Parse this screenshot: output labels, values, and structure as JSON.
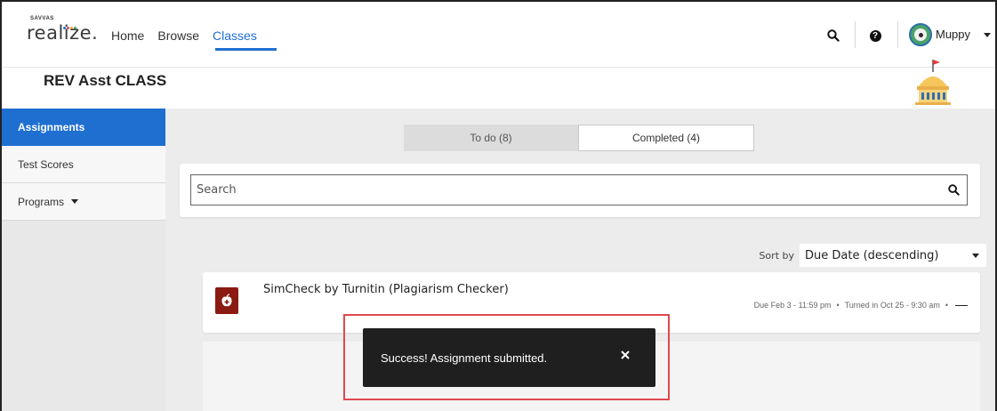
{
  "brand": {
    "small": "SAVVAS",
    "main": "realize."
  },
  "nav": {
    "home": "Home",
    "browse": "Browse",
    "classes": "Classes"
  },
  "user": {
    "name": "Muppy"
  },
  "class_title": "REV Asst CLASS",
  "sidebar": {
    "items": [
      {
        "label": "Assignments",
        "active": true
      },
      {
        "label": "Test Scores",
        "active": false
      },
      {
        "label": "Programs",
        "active": false
      }
    ]
  },
  "tabs": [
    {
      "label": "To do (8)",
      "active": false
    },
    {
      "label": "Completed (4)",
      "active": true
    }
  ],
  "search": {
    "placeholder": "Search",
    "value": ""
  },
  "sort": {
    "label": "Sort by",
    "value": "Due Date (descending)"
  },
  "assignment": {
    "title": "SimCheck by Turnitin (Plagiarism Checker)",
    "due": "Due Feb 3 - 11:59 pm",
    "turned_in": "Turned in Oct 25 - 9:30 am",
    "separator": "•"
  },
  "toast": {
    "message": "Success! Assignment submitted."
  },
  "colors": {
    "accent": "#1f6fd1",
    "toast_bg": "#1f1f1f",
    "highlight": "#e0484e",
    "assignment_icon": "#8b1a12"
  },
  "icons": [
    "search-icon",
    "help-icon",
    "avatar",
    "caret-down-icon",
    "apple-icon",
    "close-icon",
    "capitol-icon"
  ]
}
